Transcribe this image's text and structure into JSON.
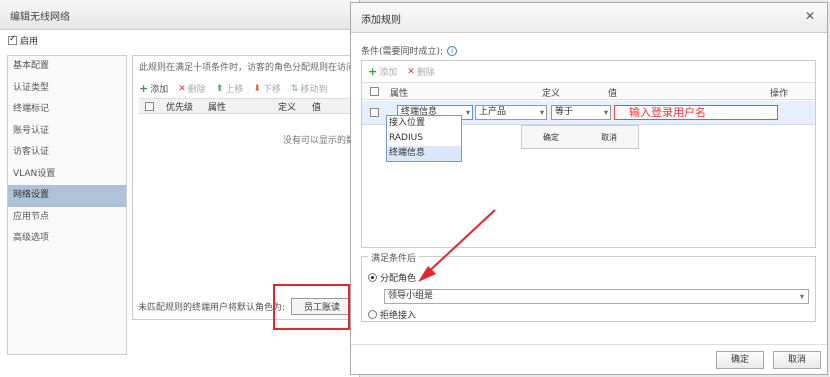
{
  "background_dialog": {
    "title": "编辑无线网络",
    "enable_label": "启用",
    "sidebar": [
      {
        "label": "基本配置"
      },
      {
        "label": "认证类型"
      },
      {
        "label": "终端标记"
      },
      {
        "label": "账号认证"
      },
      {
        "label": "访客认证"
      },
      {
        "label": "VLAN设置"
      },
      {
        "label": "网络设置"
      },
      {
        "label": "应用节点"
      },
      {
        "label": "高级选项"
      }
    ],
    "active_sidebar_index": 6,
    "description": "此规则在满足十项条件时，访客的角色分配规则在访问权",
    "toolbar": {
      "add": "添加",
      "delete": "删除",
      "up": "上移",
      "down": "下移",
      "move_to": "移动到"
    },
    "table_headers": {
      "priority": "优先级",
      "attribute": "属性",
      "definition": "定义",
      "value": "值"
    },
    "empty_text": "没有可以显示的数",
    "bottom_label": "未匹配规则的终端用户将默认角色为:",
    "bottom_select_value": "员工账读"
  },
  "dialog": {
    "title": "添加规则",
    "close_label": "✕",
    "conditions_label": "条件(需要同时成立):",
    "toolbar": {
      "add": "添加",
      "delete": "删除"
    },
    "headers": {
      "attribute": "属性",
      "operator": "",
      "definition": "定义",
      "value": "值",
      "action": "操作"
    },
    "row": {
      "attribute": "终端信息",
      "operator": "上产品",
      "definition": "等于",
      "value": "输入登录用户名",
      "value_annotation": "输入登录用户名"
    },
    "dropdown_options": [
      "接入位置",
      "RADIUS",
      "终端信息"
    ],
    "dropdown_highlight": 2,
    "popup_buttons": {
      "ok": "确定",
      "cancel": "取消"
    },
    "after_section": {
      "legend": "满足条件后",
      "assign_role_label": "分配角色",
      "role_value": "领导小组是",
      "deny_label": "拒绝接入"
    },
    "footer": {
      "ok": "确定",
      "cancel": "取消"
    }
  },
  "colors": {
    "annotation_red": "#e0282d",
    "highlight_blue": "#e6efff",
    "active_sidebar": "#aec3d9"
  }
}
